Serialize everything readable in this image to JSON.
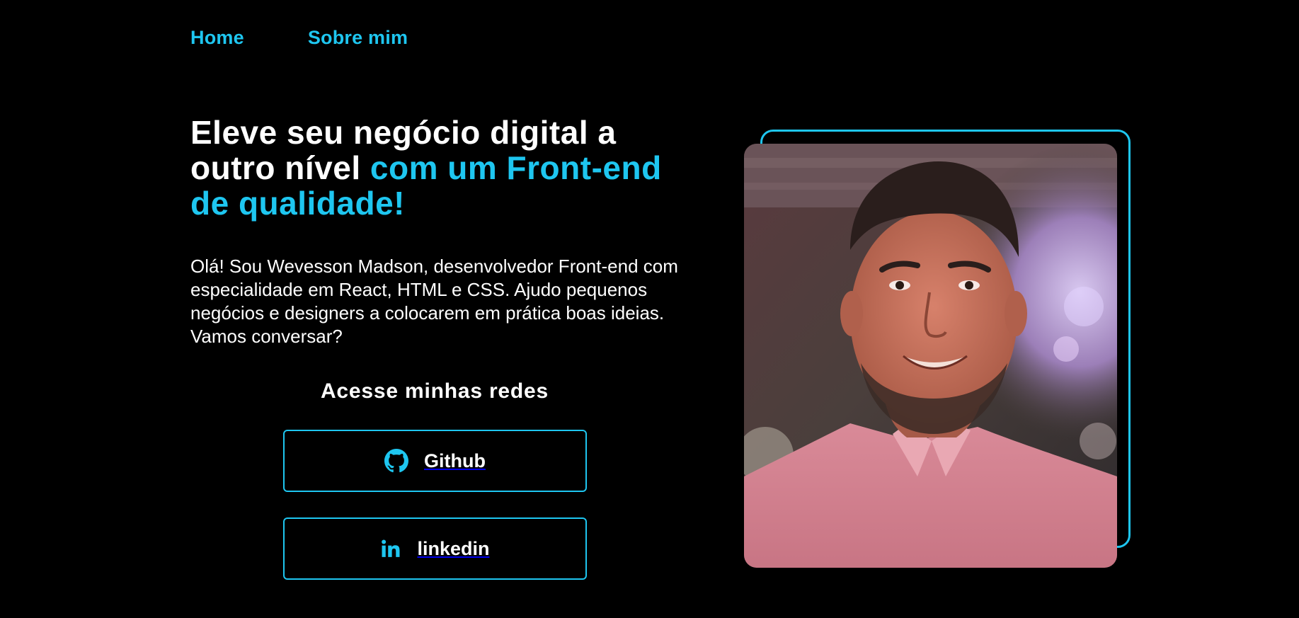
{
  "nav": {
    "home_label": "Home",
    "about_label": "Sobre mim"
  },
  "hero": {
    "title_white": "Eleve seu negócio digital a outro nível",
    "title_accent": "com um Front-end de qualidade!",
    "intro": "Olá! Sou Wevesson Madson, desenvolvedor Front-end com especialidade em React, HTML e CSS. Ajudo pequenos negócios e designers a colocarem em prática boas ideias. Vamos conversar?"
  },
  "social": {
    "heading": "Acesse minhas redes",
    "github_label": "Github",
    "github_icon": "github-icon",
    "linkedin_label": "linkedin",
    "linkedin_icon": "linkedin-icon"
  },
  "colors": {
    "accent": "#1ec6f0",
    "background": "#000000",
    "text": "#ffffff"
  }
}
